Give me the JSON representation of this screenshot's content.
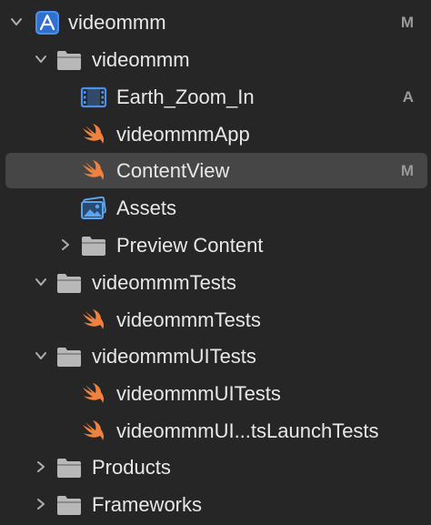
{
  "navigator": {
    "rows": [
      {
        "label": "videommm",
        "status": "M",
        "icon": "xcode-project-icon",
        "disclosure": "expanded"
      },
      {
        "label": "videommm",
        "status": "",
        "icon": "folder-icon",
        "disclosure": "expanded"
      },
      {
        "label": "Earth_Zoom_In",
        "status": "A",
        "icon": "video-file-icon",
        "disclosure": "none"
      },
      {
        "label": "videommmApp",
        "status": "",
        "icon": "swift-icon",
        "disclosure": "none"
      },
      {
        "label": "ContentView",
        "status": "M",
        "icon": "swift-icon",
        "disclosure": "none",
        "selected": true
      },
      {
        "label": "Assets",
        "status": "",
        "icon": "asset-catalog-icon",
        "disclosure": "none"
      },
      {
        "label": "Preview Content",
        "status": "",
        "icon": "folder-icon",
        "disclosure": "collapsed"
      },
      {
        "label": "videommmTests",
        "status": "",
        "icon": "folder-icon",
        "disclosure": "expanded"
      },
      {
        "label": "videommmTests",
        "status": "",
        "icon": "swift-icon",
        "disclosure": "none"
      },
      {
        "label": "videommmUITests",
        "status": "",
        "icon": "folder-icon",
        "disclosure": "expanded"
      },
      {
        "label": "videommmUITests",
        "status": "",
        "icon": "swift-icon",
        "disclosure": "none"
      },
      {
        "label": "videommmUI...tsLaunchTests",
        "status": "",
        "icon": "swift-icon",
        "disclosure": "none"
      },
      {
        "label": "Products",
        "status": "",
        "icon": "folder-icon",
        "disclosure": "collapsed"
      },
      {
        "label": "Frameworks",
        "status": "",
        "icon": "folder-icon",
        "disclosure": "collapsed"
      }
    ]
  },
  "colors": {
    "background": "#262626",
    "selection": "#464646",
    "text": "#e8e8e8",
    "status": "#9a9a9a",
    "swift": "#f0823d",
    "folder": "#b8b8b8",
    "xcode_blue": "#4a8fe8"
  }
}
